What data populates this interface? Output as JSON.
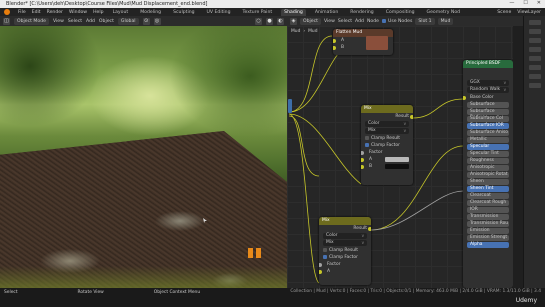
{
  "window": {
    "title": "Blender* [C:\\Users\\deh\\Desktop\\Course Files\\Mud\\Mud Displacement_end.blend]",
    "minimize": "—",
    "maximize": "☐",
    "close": "✕"
  },
  "menubar": {
    "menus": [
      "File",
      "Edit",
      "Render",
      "Window",
      "Help"
    ],
    "workspaces": [
      "Layout",
      "Modeling",
      "Sculpting",
      "UV Editing",
      "Texture Paint",
      "Shading",
      "Animation",
      "Rendering",
      "Compositing",
      "Geometry Nod"
    ],
    "active_workspace": "Shading",
    "scene_label": "Scene",
    "view_layer_label": "ViewLayer"
  },
  "viewport_header": {
    "mode": "Object Mode",
    "menus": [
      "View",
      "Select",
      "Add",
      "Object"
    ],
    "transform": "Global"
  },
  "node_editor_header": {
    "type": "Object",
    "menus": [
      "View",
      "Select",
      "Add",
      "Node"
    ],
    "use_nodes_label": "Use Nodes",
    "slot": "Slot 1",
    "material": "Mud"
  },
  "breadcrumb": {
    "object": "Mud",
    "material": "Mud"
  },
  "nodes": {
    "top": {
      "title": "Flatten Mud",
      "inputs": [
        "A",
        "B"
      ]
    },
    "mix1": {
      "title": "Mix",
      "output": "Result",
      "data_type": "Color",
      "blend": "Mix",
      "clamp_result": "Clamp Result",
      "clamp_factor": "Clamp Factor",
      "clamp_result_checked": false,
      "clamp_factor_checked": true,
      "factor": "Factor",
      "a": "A",
      "b": "B",
      "a_color": "#b9b9b9",
      "b_color": "#0e0e0e"
    },
    "mix2": {
      "title": "Mix",
      "output": "Result",
      "data_type": "Color",
      "blend": "Mix",
      "clamp_result": "Clamp Result",
      "clamp_factor": "Clamp Factor",
      "clamp_result_checked": false,
      "clamp_factor_checked": true,
      "factor": "Factor",
      "a": "A"
    },
    "principled": {
      "title": "Principled BSDF",
      "distribution": "GGX",
      "subsurface_method": "Random Walk",
      "base_color": "Base Color",
      "fields": [
        {
          "label": "Subsurface",
          "highlight": false
        },
        {
          "label": "Subsurface Radius",
          "highlight": false
        },
        {
          "label": "Subsurface Col",
          "highlight": false
        },
        {
          "label": "Subsurface IOR",
          "highlight": true
        },
        {
          "label": "Subsurface Aniso",
          "highlight": false
        },
        {
          "label": "Metallic",
          "highlight": false
        },
        {
          "label": "Specular",
          "highlight": true
        },
        {
          "label": "Specular Tint",
          "highlight": false
        },
        {
          "label": "Roughness",
          "highlight": false
        },
        {
          "label": "Anisotropic",
          "highlight": false
        },
        {
          "label": "Anisotropic Rotat",
          "highlight": false
        },
        {
          "label": "Sheen",
          "highlight": false
        },
        {
          "label": "Sheen Tint",
          "highlight": true
        },
        {
          "label": "Clearcoat",
          "highlight": false
        },
        {
          "label": "Clearcoat Rough",
          "highlight": false
        },
        {
          "label": "IOR",
          "highlight": false
        },
        {
          "label": "Transmission",
          "highlight": false
        },
        {
          "label": "Transmission Rou",
          "highlight": false
        },
        {
          "label": "Emission",
          "highlight": false
        },
        {
          "label": "Emission Strengt",
          "highlight": false
        },
        {
          "label": "Alpha",
          "highlight": true
        }
      ]
    }
  },
  "statusbar": {
    "select": "Select",
    "rotate": "Rotate View",
    "context_menu": "Object Context Menu",
    "stats": "Collection | Mud | Verts:0 | Faces:0 | Tris:0 | Objects:0/1 | Memory: 463.0 MiB | 2/4.0 GiB | VRAM: 1.3/11.0 GiB | 3.4",
    "brand": "Udemy"
  },
  "colors": {
    "accent": "#e87d0d",
    "highlight": "#4772b3",
    "mix_header": "#6d6b1e",
    "principled_header": "#286b3d",
    "socket_yellow": "#c7c729"
  }
}
